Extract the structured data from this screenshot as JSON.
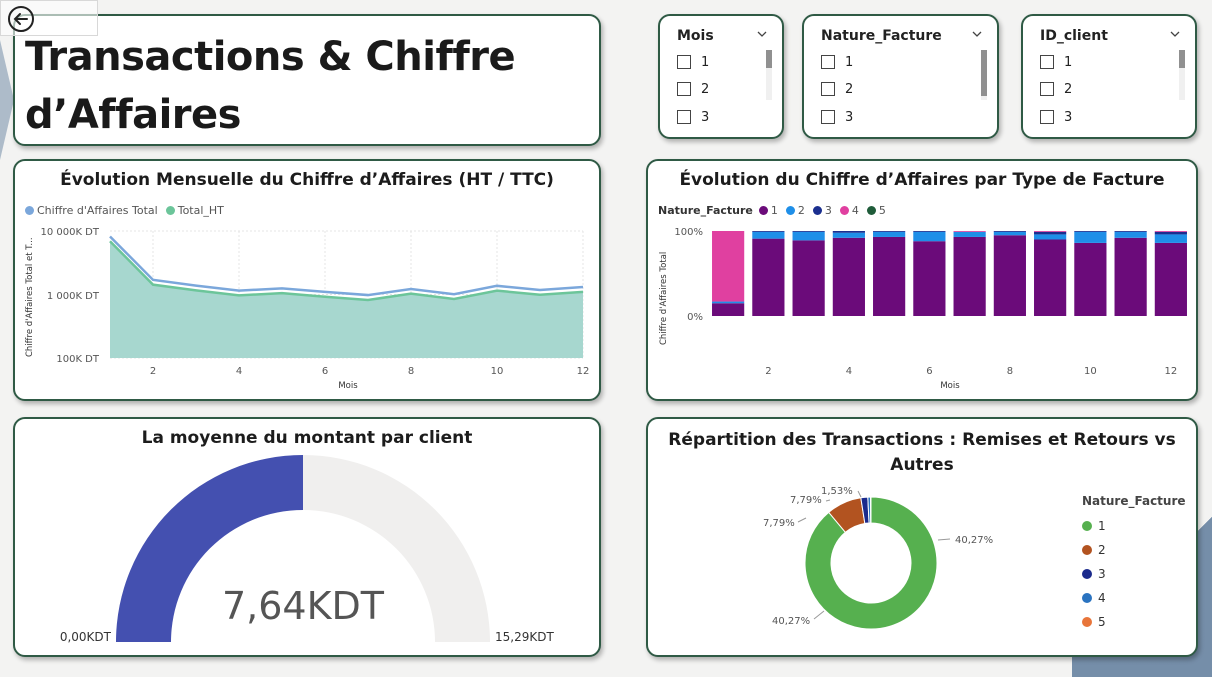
{
  "page": {
    "title": "Transactions & Chiffre d’Affaires"
  },
  "slicers": [
    {
      "title": "Mois",
      "options": [
        "1",
        "2",
        "3"
      ]
    },
    {
      "title": "Nature_Facture",
      "options": [
        "1",
        "2",
        "3"
      ]
    },
    {
      "title": "ID_client",
      "options": [
        "1",
        "2",
        "3"
      ]
    }
  ],
  "line_chart": {
    "title": "Évolution Mensuelle du Chiffre d’Affaires (HT / TTC)",
    "legend": [
      "Chiffre d'Affaires Total",
      "Total_HT"
    ],
    "ylabel": "Chiffre d'Affaires Total et T...",
    "xlabel": "Mois",
    "yticks": [
      "10 000K DT",
      "1 000K DT",
      "100K DT"
    ],
    "xticks": [
      "2",
      "4",
      "6",
      "8",
      "10",
      "12"
    ]
  },
  "bar_chart": {
    "title": "Évolution du Chiffre d’Affaires par Type de Facture",
    "legend_title": "Nature_Facture",
    "legend": [
      "1",
      "2",
      "3",
      "4",
      "5"
    ],
    "ylabel": "Chiffre d'Affaires Total",
    "xlabel": "Mois",
    "yticks": [
      "100%",
      "0%"
    ],
    "xticks": [
      "2",
      "4",
      "6",
      "8",
      "10",
      "12"
    ]
  },
  "gauge": {
    "title": "La moyenne du montant par client",
    "value_label": "7,64KDT",
    "min_label": "0,00KDT",
    "max_label": "15,29KDT"
  },
  "donut": {
    "title": "Répartition des Transactions : Remises et Retours vs Autres",
    "legend_title": "Nature_Facture",
    "legend": [
      "1",
      "2",
      "3",
      "4",
      "5"
    ],
    "labels": [
      "40,27%",
      "40,27%",
      "7,79%",
      "7,79%",
      "1,53%"
    ]
  },
  "colors": {
    "border": "#2f5a45",
    "line_total": "#7ba7db",
    "line_ht": "#6cc59a",
    "area": "#a7d7cf",
    "nf1_bar": "#6b0b7a",
    "nf2_bar": "#1f8fe8",
    "nf3_bar": "#1b2f8f",
    "nf4_bar": "#e040a0",
    "nf5_bar": "#1f5c3a",
    "gauge_fill": "#4450b0",
    "gauge_bg": "#f0efee",
    "pie1": "#56b04f",
    "pie2": "#b25320",
    "pie3": "#1b2a8c",
    "pie4": "#2a73c0",
    "pie5": "#e8753a"
  },
  "chart_data": [
    {
      "type": "area",
      "title": "Évolution Mensuelle du Chiffre d’Affaires (HT / TTC)",
      "xlabel": "Mois",
      "ylabel": "Chiffre d'Affaires Total et T...",
      "yscale": "log",
      "ylim": [
        100,
        10000
      ],
      "x": [
        1,
        2,
        3,
        4,
        5,
        6,
        7,
        8,
        9,
        10,
        11,
        12
      ],
      "series": [
        {
          "name": "Chiffre d'Affaires Total",
          "values": [
            8200,
            1700,
            1380,
            1150,
            1250,
            1100,
            980,
            1220,
            1010,
            1370,
            1180,
            1310
          ]
        },
        {
          "name": "Total_HT",
          "values": [
            6900,
            1430,
            1160,
            970,
            1050,
            920,
            820,
            1030,
            850,
            1150,
            990,
            1100
          ]
        }
      ],
      "grid": true,
      "legend": "top-left"
    },
    {
      "type": "bar",
      "stacked": true,
      "percent": true,
      "title": "Évolution du Chiffre d’Affaires par Type de Facture",
      "xlabel": "Mois",
      "ylabel": "Chiffre d'Affaires Total",
      "ylim": [
        0,
        100
      ],
      "categories": [
        "1",
        "2",
        "3",
        "4",
        "5",
        "6",
        "7",
        "8",
        "9",
        "10",
        "11",
        "12"
      ],
      "series": [
        {
          "name": "1",
          "values": [
            15,
            91,
            89,
            92,
            93,
            88,
            93,
            95,
            90,
            86,
            92,
            86
          ]
        },
        {
          "name": "2",
          "values": [
            2,
            8,
            10,
            6,
            6,
            11,
            6,
            4,
            6,
            13,
            7,
            10
          ]
        },
        {
          "name": "3",
          "values": [
            0,
            1,
            1,
            2,
            1,
            1,
            0,
            1,
            3,
            1,
            1,
            3
          ]
        },
        {
          "name": "4",
          "values": [
            83,
            0,
            0,
            0,
            0,
            0,
            1,
            0,
            1,
            0,
            0,
            1
          ]
        },
        {
          "name": "5",
          "values": [
            0,
            0,
            0,
            0,
            0,
            0,
            0,
            0,
            0,
            0,
            0,
            0
          ]
        }
      ],
      "legend": "top-left"
    },
    {
      "type": "pie",
      "donut": true,
      "title": "Répartition des Transactions : Remises et Retours vs Autres",
      "categories": [
        "1",
        "2",
        "3",
        "4",
        "5"
      ],
      "values": [
        80.54,
        7.79,
        1.53,
        0.6,
        0.1
      ],
      "legend": "right"
    }
  ]
}
